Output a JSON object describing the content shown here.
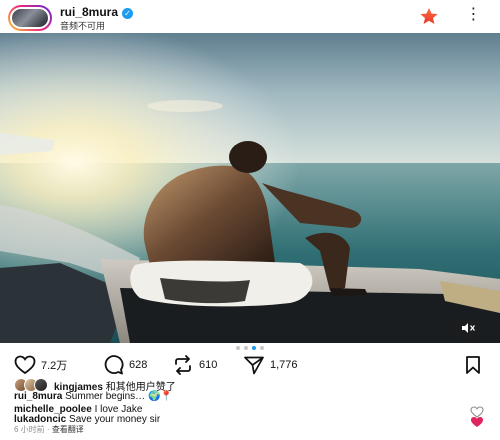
{
  "header": {
    "username": "rui_8mura",
    "subtitle": "音频不可用",
    "colors": {
      "verified": "#1d9bf0",
      "star": "#e8382f"
    }
  },
  "post": {
    "carousel_total": 4,
    "carousel_active_index": 2,
    "mute_icon": "speaker-muted-icon"
  },
  "actions": {
    "likes": "7.2万",
    "comments": "628",
    "reposts": "610",
    "shares": "1,776"
  },
  "liked_by": {
    "name": "kingjames",
    "suffix": "和其他用户赞了"
  },
  "caption": {
    "username": "rui_8mura",
    "text": "Summer begins…",
    "emoji": "🌍📍"
  },
  "comments": [
    {
      "username": "michelle_poolee",
      "text": "I love Jake",
      "liked": false
    },
    {
      "username": "lukadoncic",
      "text": "Save your money sir",
      "liked": true
    }
  ],
  "meta": {
    "time": "6 小时前",
    "separator": "·",
    "translate": "查看翻译"
  }
}
